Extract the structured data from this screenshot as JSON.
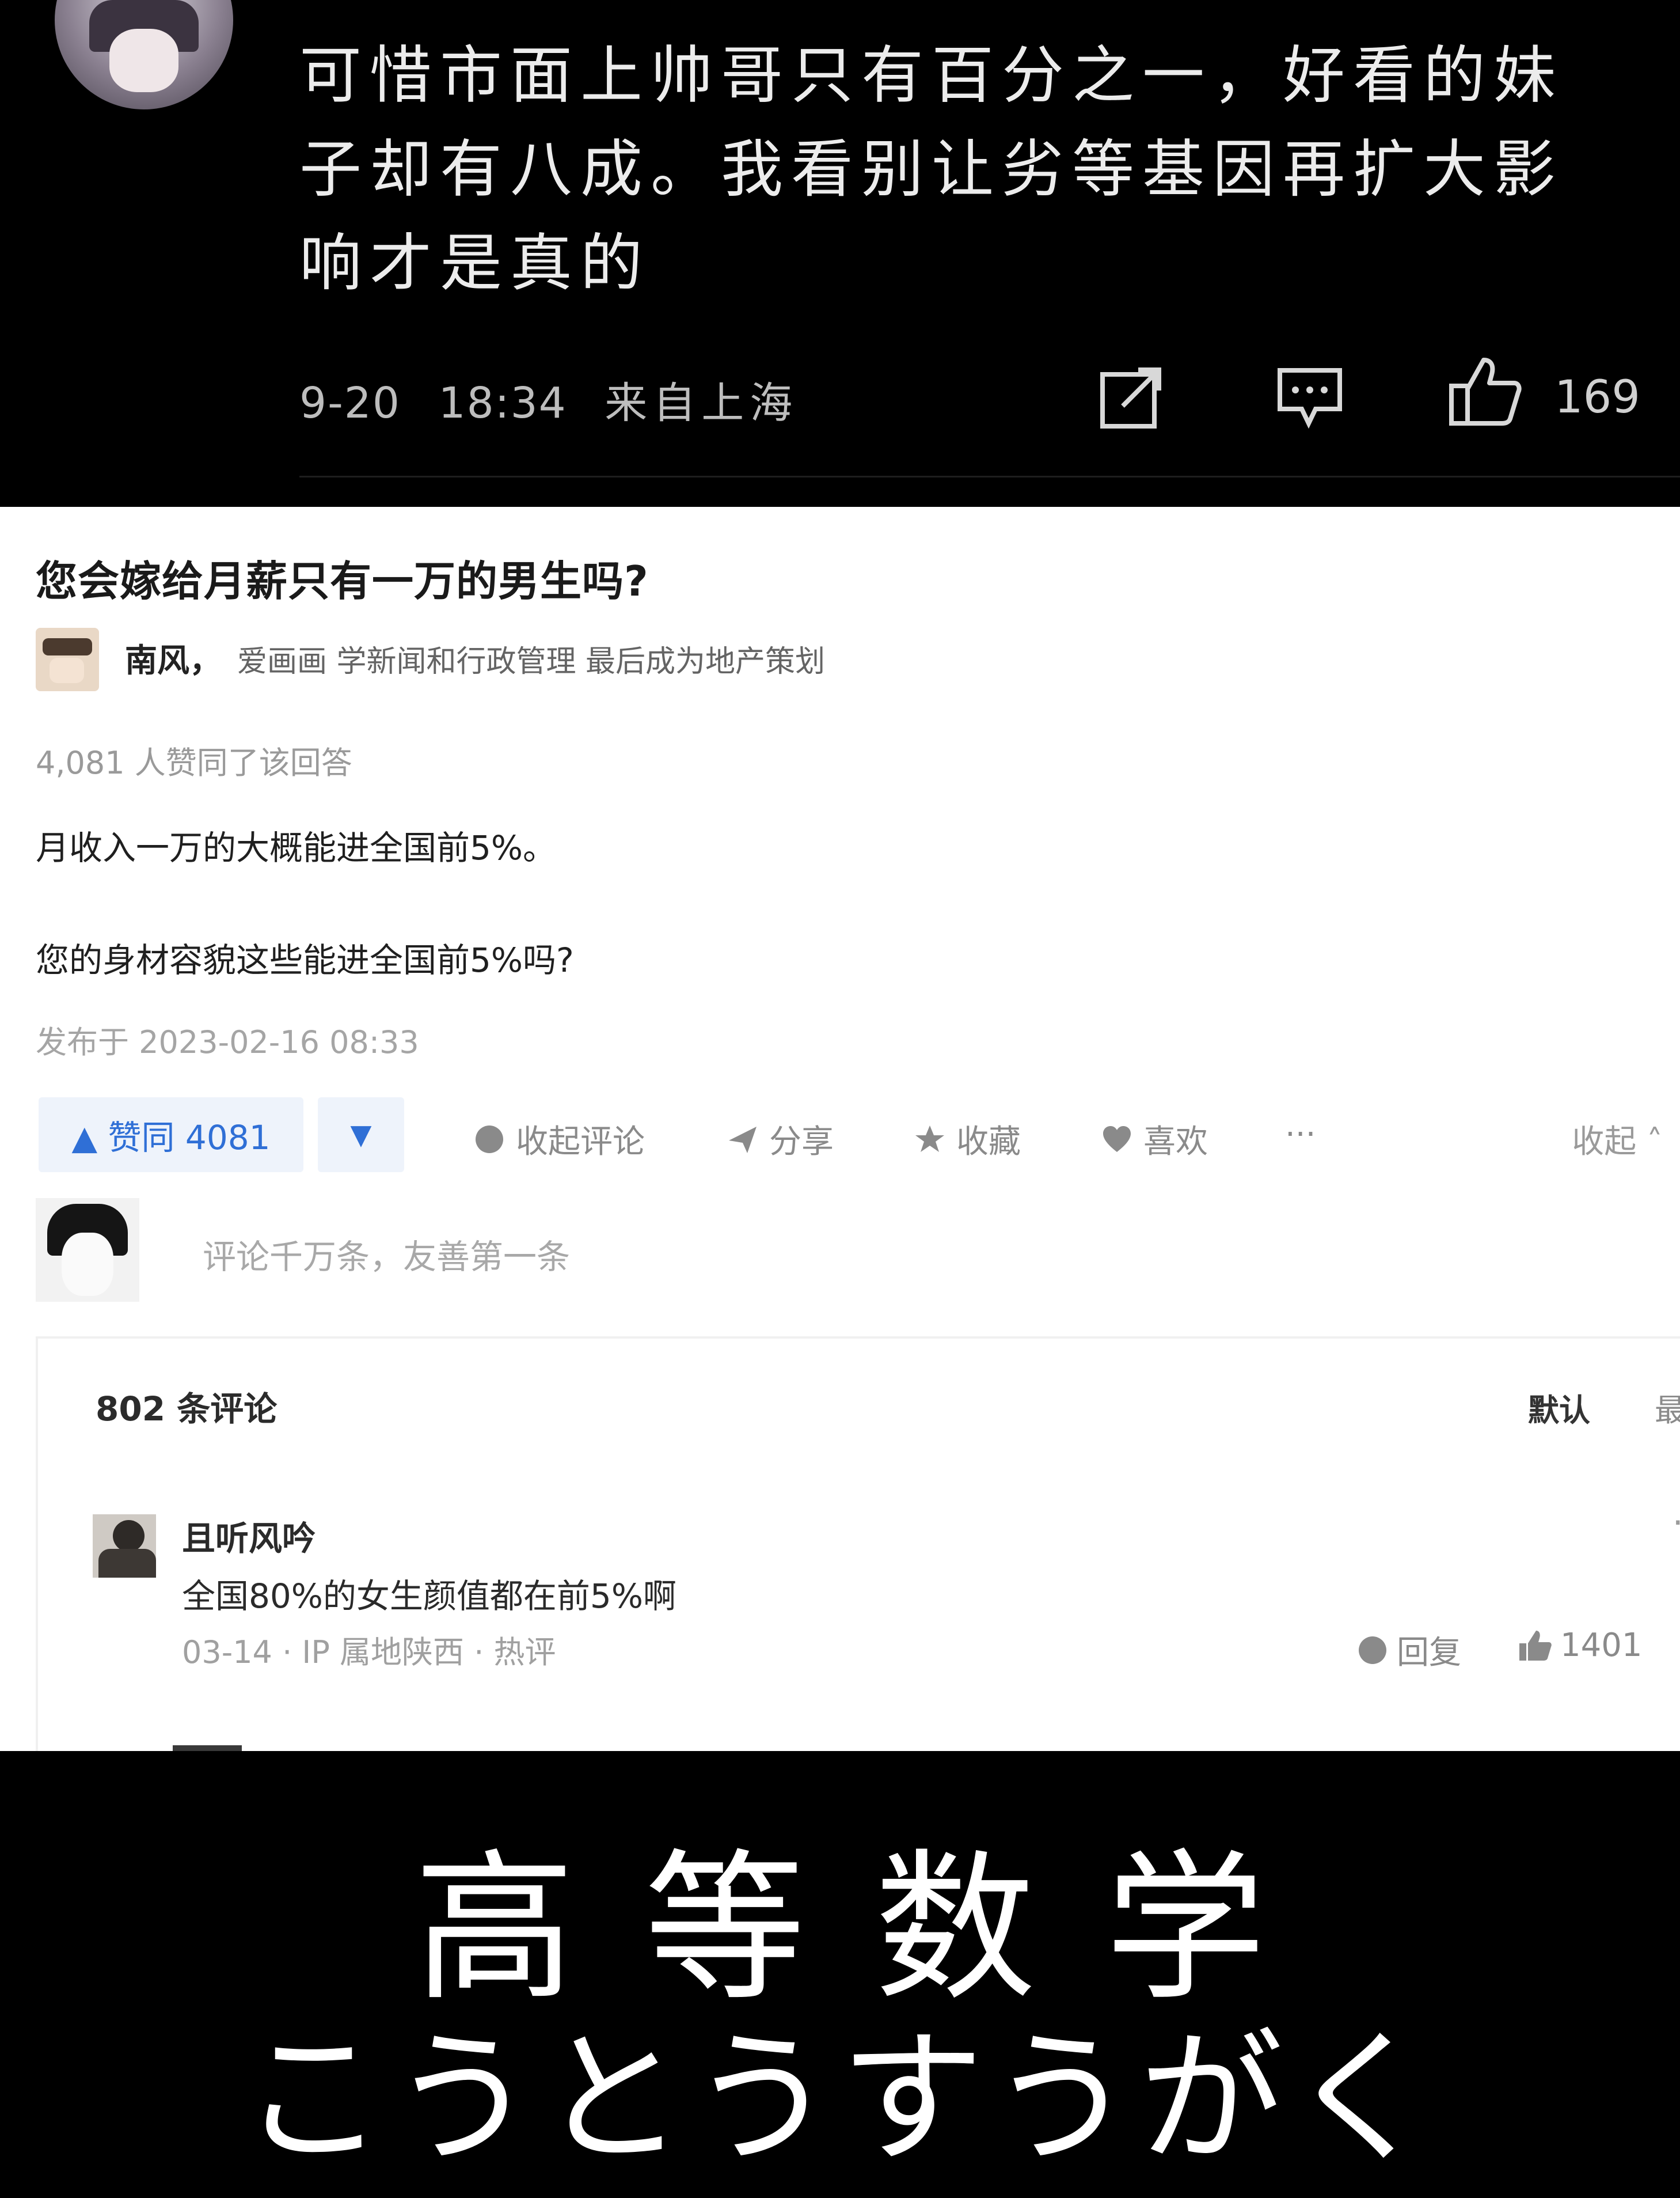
{
  "top_comment": {
    "text": "可惜市面上帅哥只有百分之一，好看的妹子却有八成。我看别让劣等基因再扩大影响才是真的",
    "date": "9-20",
    "time": "18:34",
    "location": "来自上海",
    "like_count": "169",
    "icons": [
      "share-icon",
      "comment-icon",
      "thumbs-up-icon"
    ]
  },
  "question": {
    "title": "您会嫁给月薪只有一万的男生吗?",
    "author_name": "南风，",
    "author_bio": "爱画画 学新闻和行政管理 最后成为地产策划",
    "agree_text": "4,081 人赞同了该回答",
    "answer_p1": "月收入一万的大概能进全国前5%。",
    "answer_p2": "您的身材容貌这些能进全国前5%吗?",
    "published": "发布于 2023-02-16 08:33"
  },
  "actions": {
    "upvote_label": "▲ 赞同 4081",
    "downvote_label": "▼",
    "collapse_comments": "收起评论",
    "share": "分享",
    "favorite": "收藏",
    "like": "喜欢",
    "more": "···",
    "collapse": "收起 ˄"
  },
  "comment_input": {
    "placeholder": "评论千万条，友善第一条"
  },
  "comments": {
    "count_label": "802 条评论",
    "sort_default": "默认",
    "sort_newest": "最新",
    "items": [
      {
        "user": "且听风吟",
        "text": "全国80%的女生颜值都在前5%啊",
        "meta": "03-14 · IP 属地陕西 · 热评",
        "reply": "回复",
        "likes": "1401",
        "more": "···"
      }
    ]
  },
  "caption": {
    "chinese": "高等数学",
    "kana": "こうとうすうがく"
  },
  "colors": {
    "accent_blue": "#2f6fd6",
    "dark_bg": "#000000",
    "panel_bg": "#ffffff"
  }
}
